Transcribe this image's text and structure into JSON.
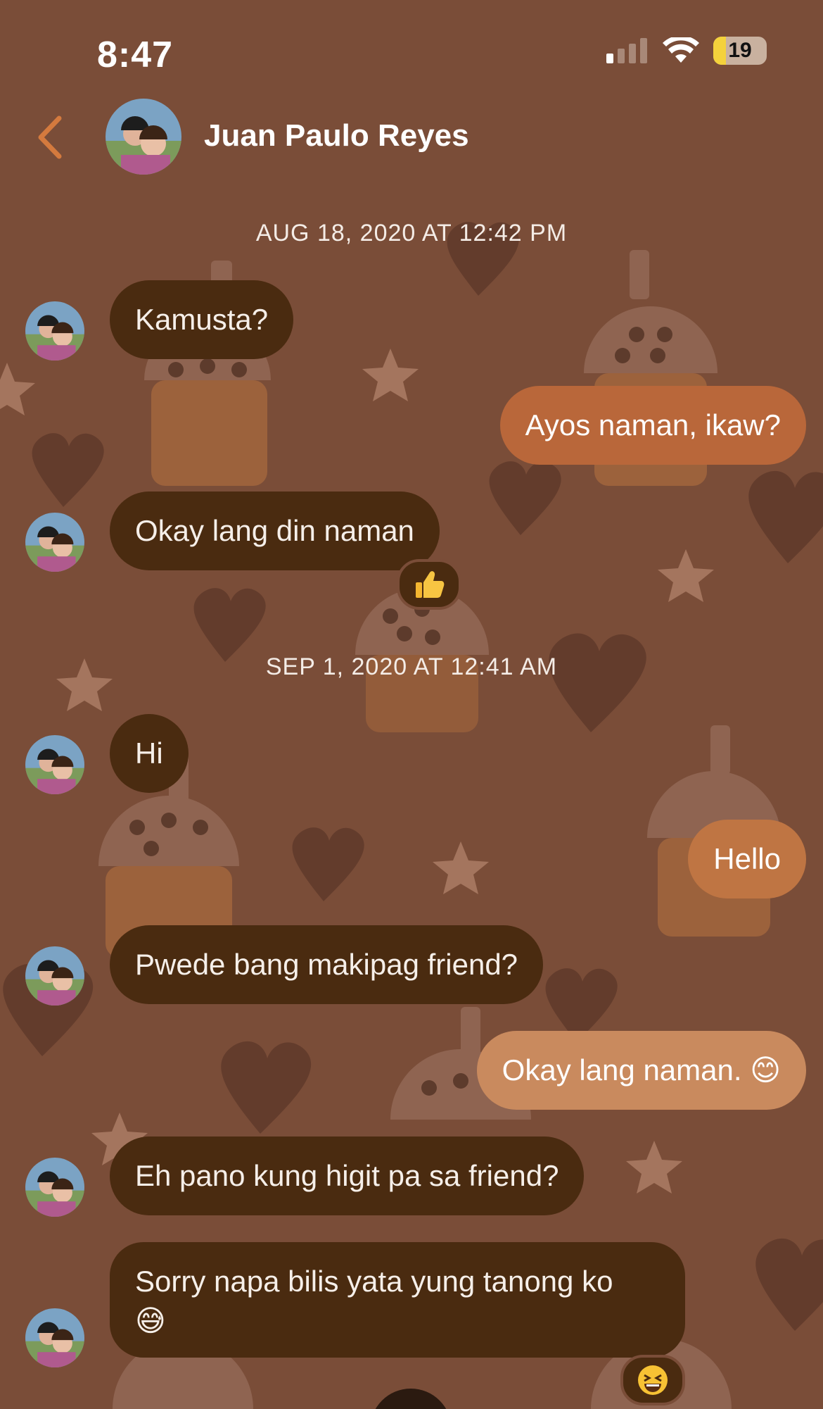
{
  "status_bar": {
    "time": "8:47",
    "battery": "19"
  },
  "header": {
    "contact_name": "Juan Paulo Reyes"
  },
  "conversation": {
    "timestamp_1": "AUG 18, 2020 AT 12:42 PM",
    "timestamp_2": "SEP 1, 2020 AT 12:41 AM",
    "messages": [
      {
        "sender": "them",
        "text": "Kamusta?"
      },
      {
        "sender": "me",
        "text": "Ayos naman, ikaw?"
      },
      {
        "sender": "them",
        "text": "Okay lang din naman",
        "reaction": "thumbs-up"
      },
      {
        "sender": "them",
        "text": "Hi"
      },
      {
        "sender": "me",
        "text": "Hello"
      },
      {
        "sender": "them",
        "text": "Pwede bang makipag friend?"
      },
      {
        "sender": "me",
        "text": "Okay lang naman. 😊"
      },
      {
        "sender": "them",
        "text": "Eh pano kung higit pa sa friend?"
      },
      {
        "sender": "them",
        "text": "Sorry napa bilis yata yung tanong ko",
        "emoji": "😅",
        "reaction": "laughing"
      }
    ]
  },
  "colors": {
    "background": "#7a4d38",
    "incoming_bubble": "#4a2b10",
    "outgoing_bubble_top": "#b9673a",
    "outgoing_bubble_bottom": "#c98a5e",
    "back_chevron": "#d47a3e"
  }
}
